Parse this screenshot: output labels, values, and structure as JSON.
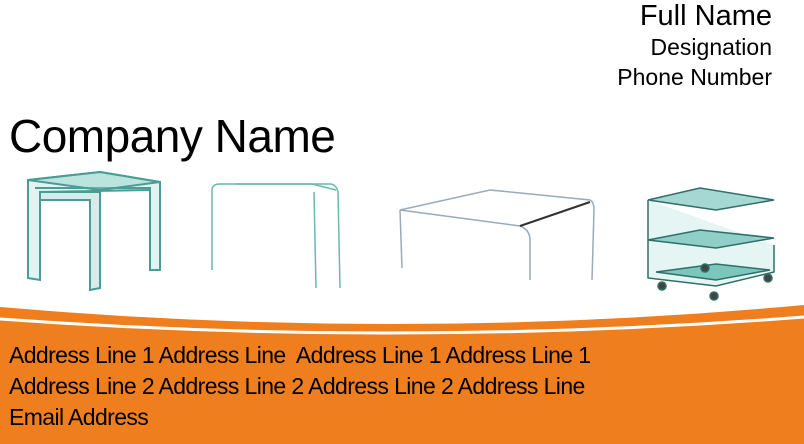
{
  "card": {
    "full_name": "Full Name",
    "designation": "Designation",
    "phone": "Phone Number",
    "company_name": "Company Name",
    "address_line_1": "Address Line 1 Address Line  Address Line 1 Address Line 1",
    "address_line_2": "Address Line 2 Address Line 2 Address Line 2 Address Line",
    "email": "Email Address"
  },
  "colors": {
    "accent": "#ef7f1e",
    "glass": "#7fc8c0"
  },
  "images": [
    "nesting-glass-tables",
    "glass-console-table",
    "glass-coffee-table",
    "glass-trolley-side-table"
  ]
}
